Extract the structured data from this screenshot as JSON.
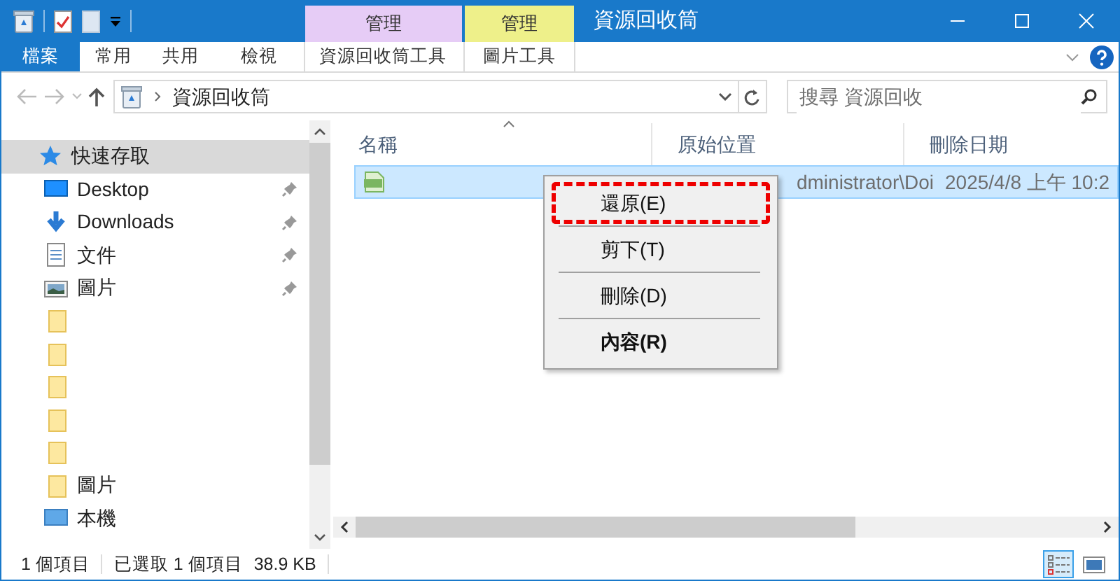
{
  "window": {
    "title": "資源回收筒"
  },
  "context_tabs": [
    {
      "label": "管理",
      "color": "#e6ccf6"
    },
    {
      "label": "管理",
      "color": "#eef08a"
    }
  ],
  "ribbon_tabs": [
    {
      "label": "檔案",
      "selected": true
    },
    {
      "label": "常用",
      "selected": false
    },
    {
      "label": "共用",
      "selected": false
    },
    {
      "label": "檢視",
      "selected": false
    },
    {
      "label": "資源回收筒工具",
      "selected": false
    },
    {
      "label": "圖片工具",
      "selected": false
    }
  ],
  "address": {
    "path": "資源回收筒"
  },
  "search": {
    "placeholder": "搜尋 資源回收"
  },
  "sidebar": {
    "items": [
      {
        "kind": "star",
        "label": "快速存取",
        "selected": true,
        "pinned": false
      },
      {
        "kind": "desktop",
        "label": "Desktop",
        "selected": false,
        "pinned": true
      },
      {
        "kind": "download",
        "label": "Downloads",
        "selected": false,
        "pinned": true
      },
      {
        "kind": "document",
        "label": "文件",
        "selected": false,
        "pinned": true
      },
      {
        "kind": "pictures",
        "label": "圖片",
        "selected": false,
        "pinned": true
      },
      {
        "kind": "folder",
        "selected": false,
        "pinned": false
      },
      {
        "kind": "folder",
        "selected": false,
        "pinned": false
      },
      {
        "kind": "folder",
        "selected": false,
        "pinned": false
      },
      {
        "kind": "folder",
        "selected": false,
        "pinned": false
      },
      {
        "kind": "folder",
        "selected": false,
        "pinned": false
      },
      {
        "kind": "folder",
        "label": "圖片",
        "selected": false,
        "pinned": false
      },
      {
        "kind": "computer",
        "label": "本機",
        "selected": false,
        "pinned": false
      }
    ]
  },
  "table": {
    "columns": [
      "名稱",
      "原始位置",
      "刪除日期"
    ],
    "rows": [
      {
        "original_location": "dministrator\\Doi",
        "date_deleted": "2025/4/8 上午 10:2",
        "selected": true
      }
    ]
  },
  "context_menu": {
    "items": [
      {
        "label": "還原(E)",
        "highlighted": true,
        "bold": false
      },
      {
        "label": "剪下(T)",
        "highlighted": false,
        "bold": false
      },
      {
        "label": "刪除(D)",
        "highlighted": false,
        "bold": false
      },
      {
        "label": "內容(R)",
        "highlighted": false,
        "bold": true
      }
    ]
  },
  "status_bar": {
    "item_count": "1 個項目",
    "selection": "已選取 1 個項目",
    "size": "38.9 KB"
  },
  "view_buttons": [
    {
      "kind": "details",
      "selected": true
    },
    {
      "kind": "thumbnails",
      "selected": false
    }
  ]
}
